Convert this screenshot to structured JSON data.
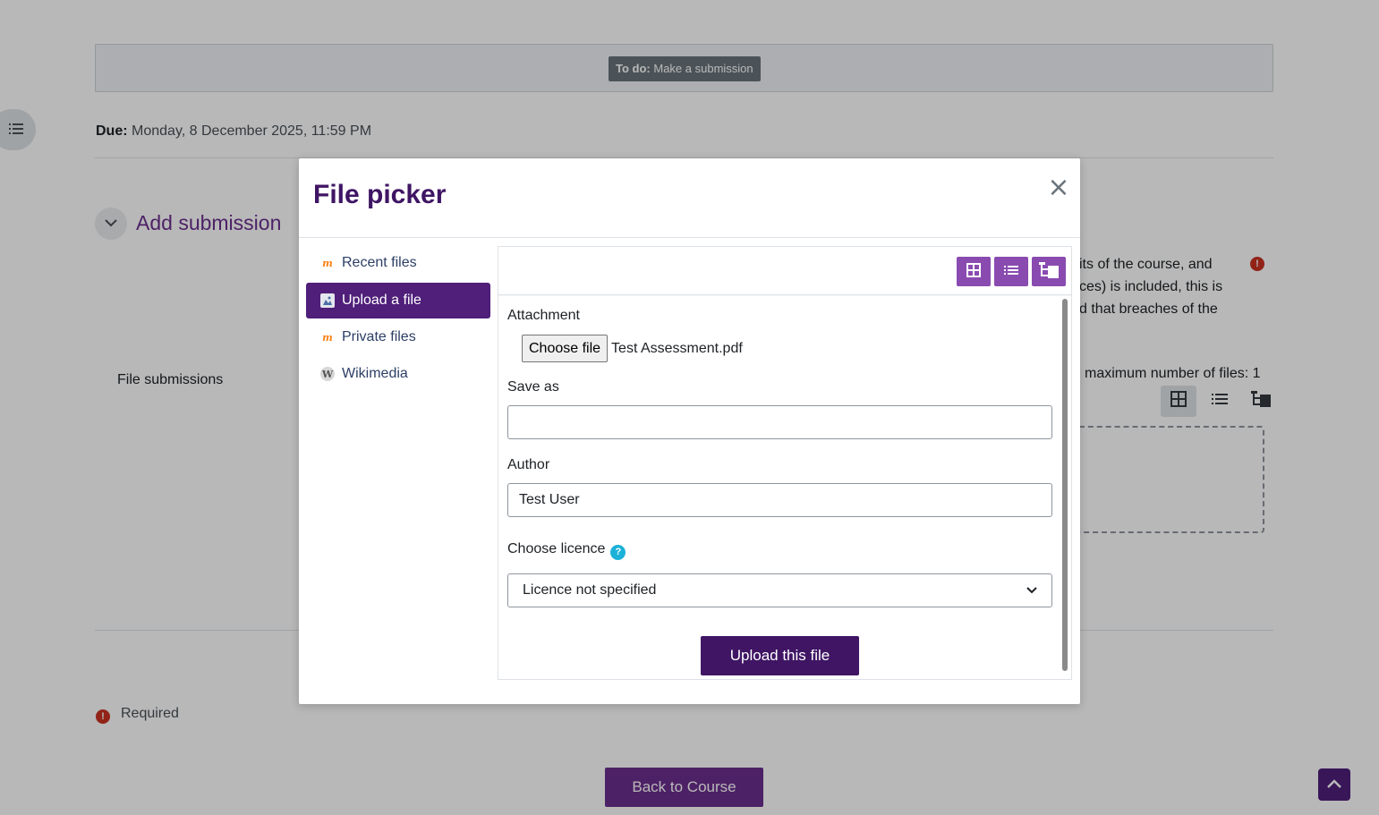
{
  "page": {
    "todo_label": "To do:",
    "todo_text": "Make a submission",
    "due_label": "Due:",
    "due_value": "Monday, 8 December 2025, 11:59 PM",
    "add_submission_title": "Add submission",
    "statement_line1": "its of the course, and",
    "statement_line2": "ces) is included, this is",
    "statement_line3": "d that breaches of the",
    "file_submissions_label": "File submissions",
    "max_files_text": "maximum number of files: 1",
    "required_text": "Required",
    "back_button": "Back to Course"
  },
  "modal": {
    "title": "File picker",
    "close_glyph": "×",
    "nav": [
      {
        "label": "Recent files"
      },
      {
        "label": "Upload a file"
      },
      {
        "label": "Private files"
      },
      {
        "label": "Wikimedia"
      }
    ],
    "form": {
      "attachment_label": "Attachment",
      "choose_file_button": "Choose file",
      "chosen_file": "Test Assessment.pdf",
      "save_as_label": "Save as",
      "save_as_value": "",
      "author_label": "Author",
      "author_value": "Test User",
      "licence_label": "Choose licence",
      "licence_selected": "Licence not specified",
      "upload_button": "Upload this file"
    }
  },
  "colors": {
    "brand_primary": "#6b2f8e",
    "brand_dark": "#3f1564",
    "nav_active": "#4f1f7a",
    "view_button": "#8a4bb0",
    "required_red": "#ca3120",
    "help_blue": "#1cb1d8"
  }
}
